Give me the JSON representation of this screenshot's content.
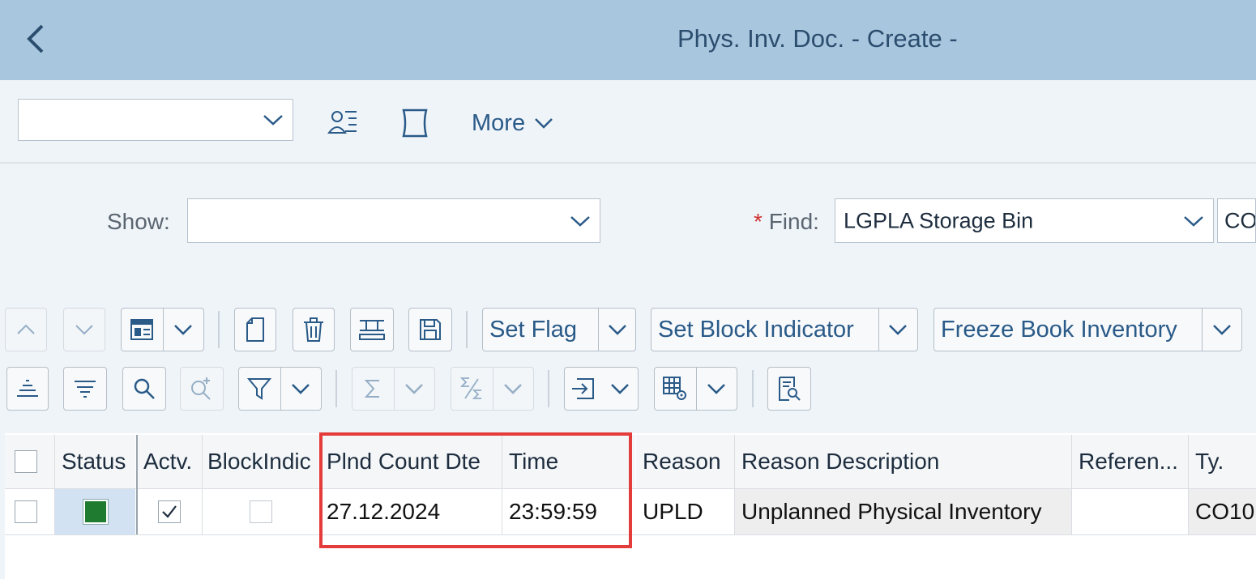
{
  "header": {
    "back_icon": "chevron-left-icon",
    "title": "Phys. Inv. Doc. - Create -"
  },
  "toolbar": {
    "variant_value": "",
    "more_label": "More",
    "icons": [
      "user-assign-icon",
      "document-blank-icon"
    ]
  },
  "filters": {
    "show_label": "Show:",
    "show_value": "",
    "find_required_marker": "*",
    "find_label": "Find:",
    "find_value": "LGPLA Storage Bin",
    "find_extra_value": "CO"
  },
  "action_toolbar": {
    "set_flag_label": "Set Flag",
    "set_block_label": "Set Block Indicator",
    "freeze_label": "Freeze Book Inventory"
  },
  "table": {
    "columns": [
      "Status",
      "Actv.",
      "BlockIndic",
      "Plnd Count Dte",
      "Time",
      "Reason",
      "Reason Description",
      "Referen...",
      "Ty."
    ],
    "rows": [
      {
        "status_color": "#1e7b2f",
        "active": true,
        "block_indicator": false,
        "planned_count_date": "27.12.2024",
        "time": "23:59:59",
        "reason": "UPLD",
        "reason_description": "Unplanned Physical Inventory",
        "reference": "",
        "type": "CO10"
      }
    ]
  },
  "colors": {
    "title_bar": "#a9c6df",
    "highlight": "#e43b3b",
    "accent": "#2a5a88"
  }
}
